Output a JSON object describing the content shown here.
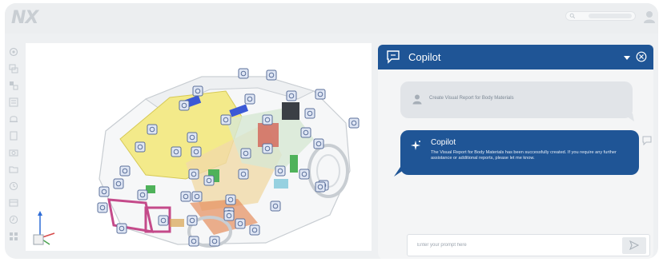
{
  "app": {
    "logo_text": "NX"
  },
  "topbar": {
    "search_icon": "search-icon",
    "avatar_icon": "user-avatar-icon"
  },
  "toolbar": {
    "tools": [
      "settings-icon",
      "layers-icon",
      "assembly-icon",
      "part-list-icon",
      "notification-icon",
      "document-icon",
      "camera-icon",
      "folder-icon",
      "history-icon",
      "package-icon",
      "history-icon",
      "grid-icon"
    ]
  },
  "viewport": {
    "model": "vehicle-assembly-cutaway",
    "colors": {
      "body_panels": "#f3ea8a",
      "chassis": "#c44a8a",
      "hotspot_fill": "#dfe6f4",
      "hotspot_border": "#5a6f9a"
    }
  },
  "copilot": {
    "title": "Copilot",
    "accent": "#1f5596",
    "messages": [
      {
        "role": "user",
        "text": "Create Visual Report for Body Materials"
      },
      {
        "role": "assistant",
        "name": "Copilot",
        "text": "The Visual Report for Body Materials has been successfully created. If you require any further assistance or additional reports, please let me know."
      }
    ],
    "prompt_placeholder": "Enter your prompt here"
  }
}
